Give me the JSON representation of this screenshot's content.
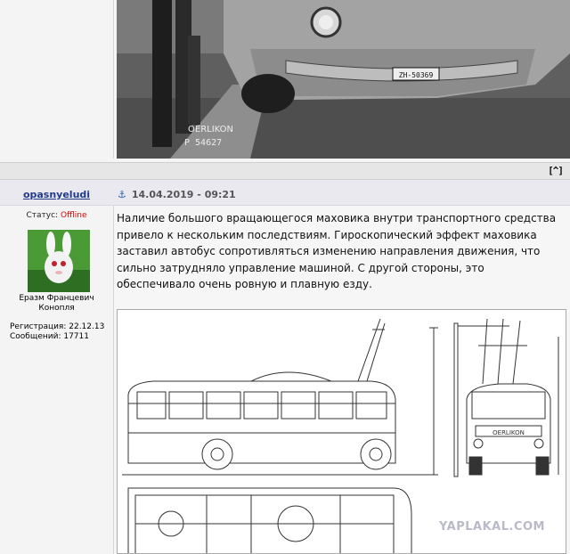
{
  "photo": {
    "plate": "ZH-50369",
    "caption_line1": "OERLIKON",
    "caption_line2": "P 54627"
  },
  "nav": {
    "up_label": "[^]"
  },
  "post": {
    "username": "opasnyeludi",
    "status_label": "Статус:",
    "status_value": "Offline",
    "nickname": "Еразм Францевич Конопля",
    "registration": "Регистрация: 22.12.13",
    "messages": "Сообщений: 17711",
    "timestamp": "14.04.2019 - 09:21",
    "text": "Наличие большого вращающегося маховика внутри транспортного средства привело к нескольким последствиям. Гироскопический эффект маховика заставил автобус сопротивляться изменению направления движения, что сильно затрудняло управление машиной. С другой стороны, это обеспечивало очень ровную и плавную езду."
  },
  "blueprint": {
    "label": "OERLIKON"
  },
  "watermark": "YAPLAKAL.COM",
  "colors": {
    "username": "#223a88",
    "offline": "#d80000",
    "anchor": "#2a5bb0"
  }
}
